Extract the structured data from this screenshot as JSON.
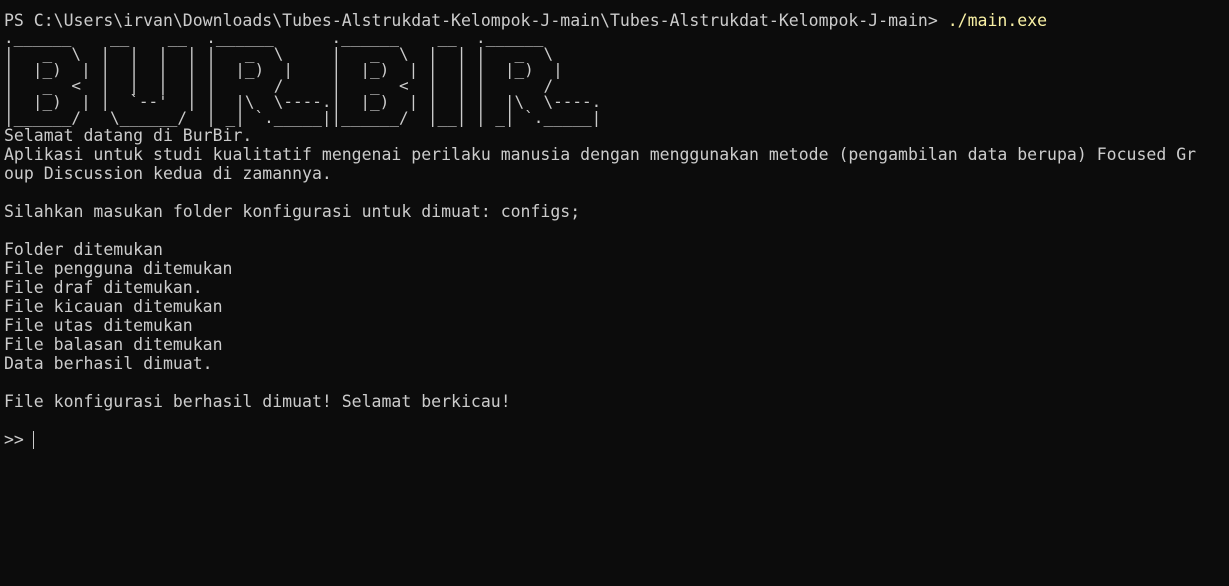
{
  "terminal": {
    "ps_path": "PS C:\\Users\\irvan\\Downloads\\Tubes-Alstrukdat-Kelompok-J-main\\Tubes-Alstrukdat-Kelompok-J-main> ",
    "command": "./main.exe",
    "ascii_banner": [
      ".______    __    __  .______      .______    __  .______",
      "|   _  \\  |  |  |  | |   _  \\     |   _  \\  |  | |   _  \\",
      "|  |_)  | |  |  |  | |  |_)  |    |  |_)  | |  | |  |_)  |",
      "|   _  <  |  |  |  | |      /     |   _  <  |  | |      /",
      "|  |_)  | |  `--'  | |  |\\  \\----.|  |_)  | |  | |  |\\  \\----.",
      "|______/   \\______/  | _| `._____||______/  |__| | _| `._____|"
    ],
    "welcome": "Selamat datang di BurBir.",
    "description_line1": "Aplikasi untuk studi kualitatif mengenai perilaku manusia dengan menggunakan metode (pengambilan data berupa) Focused Gr",
    "description_line2": "oup Discussion kedua di zamannya.",
    "config_prompt": "Silahkan masukan folder konfigurasi untuk dimuat: configs;",
    "status_lines": [
      "Folder ditemukan",
      "File pengguna ditemukan",
      "File draf ditemukan.",
      "File kicauan ditemukan",
      "File utas ditemukan",
      "File balasan ditemukan",
      "Data berhasil dimuat."
    ],
    "success_message": "File konfigurasi berhasil dimuat! Selamat berkicau!",
    "input_prompt": ">>"
  },
  "colors": {
    "background": "#0c0c0c",
    "text": "#cccccc",
    "command": "#f9f1a5"
  }
}
